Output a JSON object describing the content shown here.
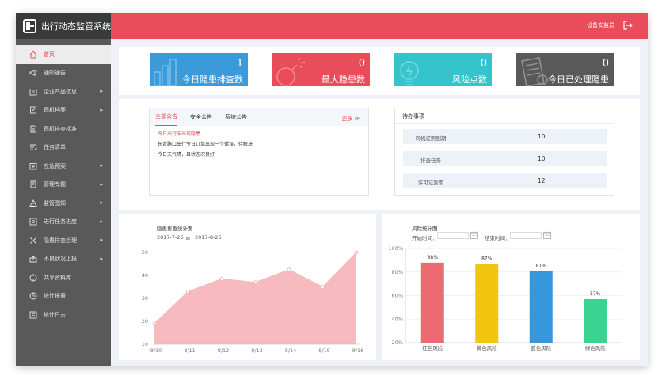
{
  "app": {
    "title": "出行动态监管系统"
  },
  "sidebar": {
    "items": [
      {
        "label": "首页",
        "icon": "home-icon",
        "active": true,
        "has_submenu": false
      },
      {
        "label": "通知通告",
        "icon": "megaphone-icon",
        "active": false,
        "has_submenu": false
      },
      {
        "label": "企业产品信息",
        "icon": "building-icon",
        "active": false,
        "has_submenu": true
      },
      {
        "label": "司机档案",
        "icon": "archive-icon",
        "active": false,
        "has_submenu": true
      },
      {
        "label": "司机排查标准",
        "icon": "document-icon",
        "active": false,
        "has_submenu": false
      },
      {
        "label": "任务清单",
        "icon": "checklist-icon",
        "active": false,
        "has_submenu": false
      },
      {
        "label": "应急预案",
        "icon": "emergency-icon",
        "active": false,
        "has_submenu": true
      },
      {
        "label": "管理专题",
        "icon": "topic-icon",
        "active": false,
        "has_submenu": true
      },
      {
        "label": "监管图知",
        "icon": "monitor-icon",
        "active": false,
        "has_submenu": true
      },
      {
        "label": "进行任务进度",
        "icon": "progress-icon",
        "active": false,
        "has_submenu": true
      },
      {
        "label": "隐患排查治理",
        "icon": "tools-icon",
        "active": false,
        "has_submenu": true
      },
      {
        "label": "不良状况上报",
        "icon": "upload-icon",
        "active": false,
        "has_submenu": true
      },
      {
        "label": "共享资料库",
        "icon": "share-icon",
        "active": false,
        "has_submenu": false
      },
      {
        "label": "统计报表",
        "icon": "pie-chart-icon",
        "active": false,
        "has_submenu": false
      },
      {
        "label": "统计日志",
        "icon": "log-icon",
        "active": false,
        "has_submenu": false
      }
    ],
    "submenu_arrow": "▸"
  },
  "header": {
    "user": "设备安监员",
    "logout_icon": "logout-icon"
  },
  "stats": [
    {
      "value": "1",
      "label": "今日隐患排查数",
      "color": "#3b9ad9",
      "icon": "bar-chart-icon"
    },
    {
      "value": "0",
      "label": "最大隐患数",
      "color": "#e94c5a",
      "icon": "bomb-icon"
    },
    {
      "value": "0",
      "label": "风险点数",
      "color": "#35c4cc",
      "icon": "bulb-icon"
    },
    {
      "value": "0",
      "label": "今日已处理隐患",
      "color": "#595959",
      "icon": "paper-icon"
    }
  ],
  "notices": {
    "tabs": [
      "全部公告",
      "安全公告",
      "系统公告"
    ],
    "more": "更多 ≫",
    "items": [
      {
        "text": "今日出行未出现隐患",
        "highlight": true
      },
      {
        "text": "长青路口出行今日订单出现一个错误，待解决",
        "highlight": false
      },
      {
        "text": "今日天气晴，且状态况良好",
        "highlight": false
      }
    ]
  },
  "todo": {
    "title": "待办事项",
    "rows": [
      {
        "label": "司机证照到期",
        "value": "10"
      },
      {
        "label": "排查任务",
        "value": "10"
      },
      {
        "label": "许可证到期",
        "value": "12"
      }
    ]
  },
  "line_chart_panel": {
    "title": "隐患排查统计图",
    "date_from": "2017-7-26",
    "date_sep": "至",
    "date_to": "2017-8-26"
  },
  "bar_chart_panel": {
    "title": "风险统计图",
    "start_label": "开始时间：",
    "end_label": "结束时间：",
    "calendar_icon": "calendar-icon"
  },
  "chart_data": [
    {
      "type": "area",
      "categories": [
        "8/10",
        "8/11",
        "8/12",
        "8/13",
        "8/14",
        "8/15",
        "8/16"
      ],
      "x": [
        "8/10",
        "8/11",
        "8/12",
        "8/13",
        "8/14",
        "8/15",
        "8/16"
      ],
      "values": [
        19,
        33,
        38.5,
        37,
        42.5,
        35,
        50
      ],
      "ylim": [
        10,
        50
      ],
      "yticks": [
        10,
        20,
        30,
        40,
        50
      ],
      "color": "#f4a3a8",
      "grid": false
    },
    {
      "type": "bar",
      "categories": [
        "红色风险",
        "黄色风险",
        "蓝色风险",
        "绿色风险"
      ],
      "values": [
        88,
        87,
        81,
        57
      ],
      "bar_labels": [
        "88%",
        "87%",
        "81%",
        "57%"
      ],
      "colors": [
        "#ec6b73",
        "#f2c60e",
        "#3597dc",
        "#3bd38f"
      ],
      "ylim": [
        20,
        100
      ],
      "yticks": [
        "20%",
        "40%",
        "60%",
        "80%",
        "100%"
      ],
      "grid": true
    }
  ]
}
